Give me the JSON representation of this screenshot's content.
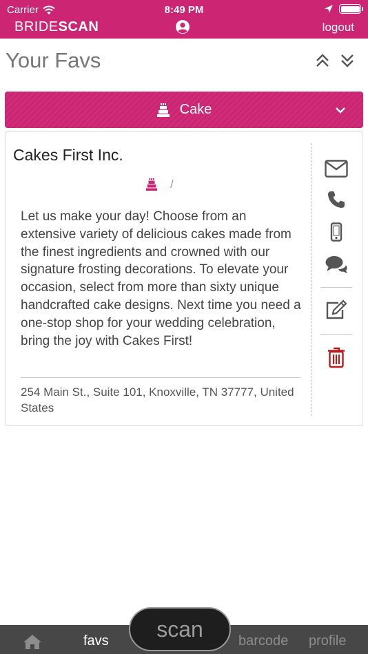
{
  "status_bar": {
    "carrier": "Carrier",
    "time": "8:49 PM"
  },
  "header": {
    "brand_light": "BRIDE",
    "brand_bold": "SCAN",
    "logout_label": "logout"
  },
  "page": {
    "title": "Your Favs"
  },
  "category": {
    "label": "Cake",
    "icon": "cake-icon"
  },
  "vendor": {
    "name": "Cakes First Inc.",
    "category_separator": "/",
    "description": "Let us make your day! Choose from an extensive variety of delicious cakes made from the finest ingredients and crowned with our signature frosting decorations. To elevate your occasion, select from more than sixty unique handcrafted cake designs. Next time you need a one-stop shop for your wedding celebration, bring the joy with Cakes First!",
    "address": "254 Main St., Suite 101, Knoxville, TN 37777, United States"
  },
  "actions": [
    "envelope-icon",
    "phone-icon",
    "mobile-icon",
    "chat-icon",
    "edit-icon",
    "trash-icon"
  ],
  "bottom_nav": {
    "favs": "favs",
    "scan": "scan",
    "barcode": "barcode",
    "profile": "profile"
  },
  "colors": {
    "brand": "#cb2573",
    "delete": "#b51c1c",
    "nav_bg": "#474747",
    "icon": "#555555"
  }
}
